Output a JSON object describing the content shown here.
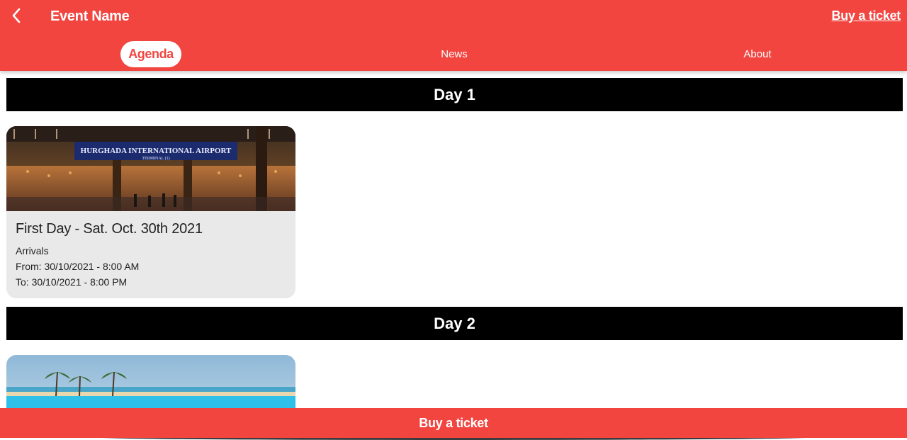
{
  "header": {
    "title": "Event Name",
    "buy_label": "Buy a ticket"
  },
  "tabs": [
    {
      "label": "Agenda",
      "active": true
    },
    {
      "label": "News",
      "active": false
    },
    {
      "label": "About",
      "active": false
    }
  ],
  "days": [
    {
      "label": "Day 1",
      "sessions": [
        {
          "image_sign": "HURGHADA INTERNATIONAL AIRPORT",
          "image_subsign": "TERMINAL (1)",
          "title": "First Day - Sat. Oct. 30th 2021",
          "subtitle": "Arrivals",
          "from": "From: 30/10/2021 - 8:00 AM",
          "to": "To: 30/10/2021 - 8:00 PM"
        }
      ]
    },
    {
      "label": "Day 2"
    }
  ],
  "bottom_bar": {
    "label": "Buy a ticket"
  },
  "colors": {
    "brand_red": "#f24540",
    "day_header_bg": "#000000",
    "card_bg": "#e9e9e9"
  }
}
